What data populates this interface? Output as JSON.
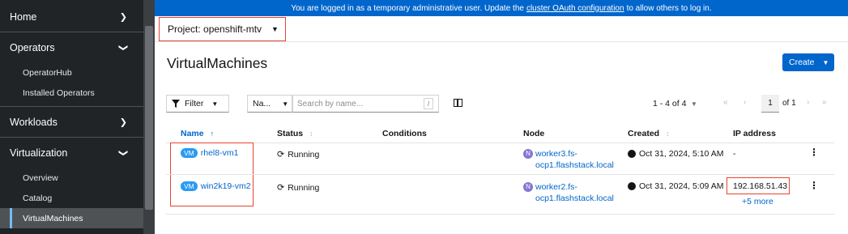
{
  "sidebar": {
    "sections": [
      {
        "label": "Home",
        "expanded": false
      },
      {
        "label": "Operators",
        "expanded": true
      },
      {
        "label": "Workloads",
        "expanded": false
      },
      {
        "label": "Virtualization",
        "expanded": true
      }
    ],
    "operators_items": [
      "OperatorHub",
      "Installed Operators"
    ],
    "virtualization_items": [
      "Overview",
      "Catalog",
      "VirtualMachines"
    ],
    "active_item": "VirtualMachines"
  },
  "banner": {
    "text_before": "You are logged in as a temporary administrative user. Update the",
    "link": "cluster OAuth configuration",
    "text_after": "to allow others to log in."
  },
  "project": {
    "label": "Project: openshift-mtv"
  },
  "page": {
    "title": "VirtualMachines",
    "create_label": "Create"
  },
  "toolbar": {
    "filter_label": "Filter",
    "name_select_label": "Na...",
    "search_placeholder": "Search by name...",
    "search_shortcut": "/"
  },
  "pagination": {
    "count": "1 - 4 of 4",
    "page": "1",
    "of_pages": "of 1"
  },
  "table": {
    "columns": [
      "Name",
      "Status",
      "Conditions",
      "Node",
      "Created",
      "IP address"
    ],
    "sorted_column": "Name",
    "rows": [
      {
        "badge": "VM",
        "name": "rhel8-vm1",
        "status": "Running",
        "conditions": "",
        "node_badge": "N",
        "node_line1": "worker3.fs-",
        "node_line2": "ocp1.flashstack.local",
        "created": "Oct 31, 2024, 5:10 AM",
        "ip": "-",
        "ip_more": ""
      },
      {
        "badge": "VM",
        "name": "win2k19-vm2",
        "status": "Running",
        "conditions": "",
        "node_badge": "N",
        "node_line1": "worker2.fs-",
        "node_line2": "ocp1.flashstack.local",
        "created": "Oct 31, 2024, 5:09 AM",
        "ip": "192.168.51.43",
        "ip_more": "+5 more"
      }
    ]
  },
  "colors": {
    "sidebar_bg": "#212427",
    "banner_bg": "#0066cc",
    "link": "#0066cc",
    "highlight_box": "#e8432f"
  }
}
